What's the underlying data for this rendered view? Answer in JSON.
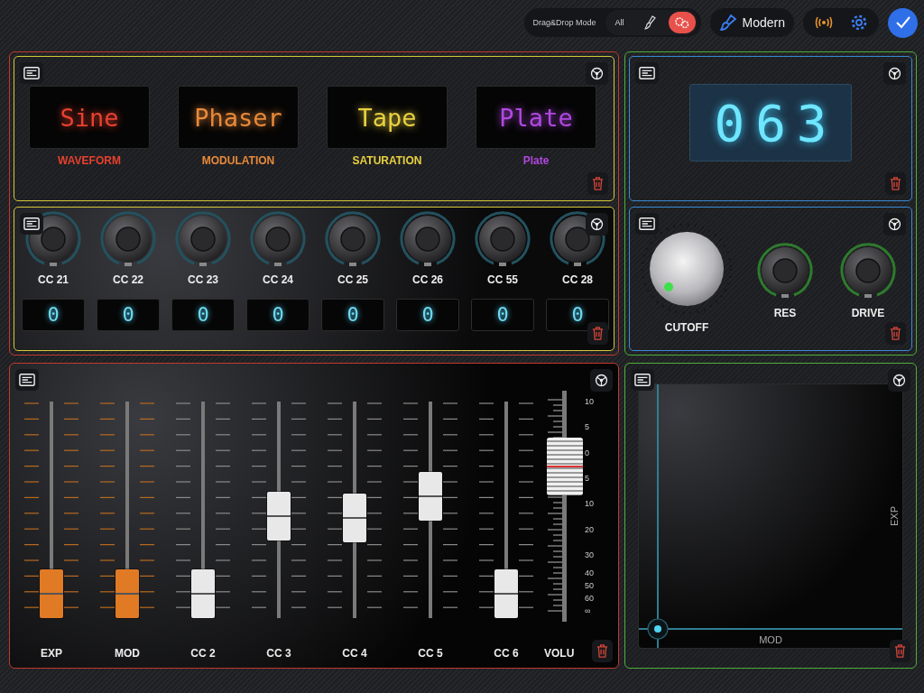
{
  "toolbar": {
    "mode_label": "Drag&Drop Mode",
    "mode_options": [
      {
        "kind": "text",
        "label": "All",
        "selected": false
      },
      {
        "kind": "brush",
        "selected": false
      },
      {
        "kind": "gears",
        "selected": true
      }
    ],
    "theme_button": "Modern"
  },
  "display_panel": {
    "displays": [
      {
        "value": "Sine",
        "label": "WAVEFORM",
        "color": "#e8402f"
      },
      {
        "value": "Phaser",
        "label": "MODULATION",
        "color": "#e8893a"
      },
      {
        "value": "Tape",
        "label": "SATURATION",
        "color": "#e8d040"
      },
      {
        "value": "Plate",
        "label": "Plate",
        "color": "#b048e0"
      }
    ]
  },
  "knob_panel": {
    "knobs": [
      {
        "label": "CC 21",
        "value": "0"
      },
      {
        "label": "CC 22",
        "value": "0"
      },
      {
        "label": "CC 23",
        "value": "0"
      },
      {
        "label": "CC 24",
        "value": "0"
      },
      {
        "label": "CC 25",
        "value": "0"
      },
      {
        "label": "CC 26",
        "value": "0"
      },
      {
        "label": "CC 55",
        "value": "0"
      },
      {
        "label": "CC 28",
        "value": "0"
      }
    ]
  },
  "number_panel": {
    "value": "063"
  },
  "filter_panel": {
    "knobs": [
      {
        "kind": "metal",
        "label": "CUTOFF"
      },
      {
        "kind": "ring",
        "label": "RES"
      },
      {
        "kind": "ring",
        "label": "DRIVE"
      }
    ]
  },
  "fader_panel": {
    "faders": [
      {
        "kind": "channel",
        "label": "EXP",
        "level": 0,
        "color": "#e07a25"
      },
      {
        "kind": "channel",
        "label": "MOD",
        "level": 0,
        "color": "#e07a25"
      },
      {
        "kind": "channel",
        "label": "CC 2",
        "level": 0,
        "color": "#e8e8e8"
      },
      {
        "kind": "channel",
        "label": "CC 3",
        "level": 0.46,
        "color": "#e8e8e8"
      },
      {
        "kind": "channel",
        "label": "CC 4",
        "level": 0.45,
        "color": "#e8e8e8"
      },
      {
        "kind": "channel",
        "label": "CC 5",
        "level": 0.58,
        "color": "#e8e8e8"
      },
      {
        "kind": "channel",
        "label": "CC 6",
        "level": 0,
        "color": "#e8e8e8"
      },
      {
        "kind": "volume",
        "label": "VOLU",
        "level": 0.73,
        "scale": [
          "10",
          "5",
          "0",
          "5",
          "10",
          "20",
          "30",
          "40",
          "50",
          "60",
          "∞"
        ]
      }
    ]
  },
  "xy_pad": {
    "x_label": "MOD",
    "y_label": "EXP"
  }
}
